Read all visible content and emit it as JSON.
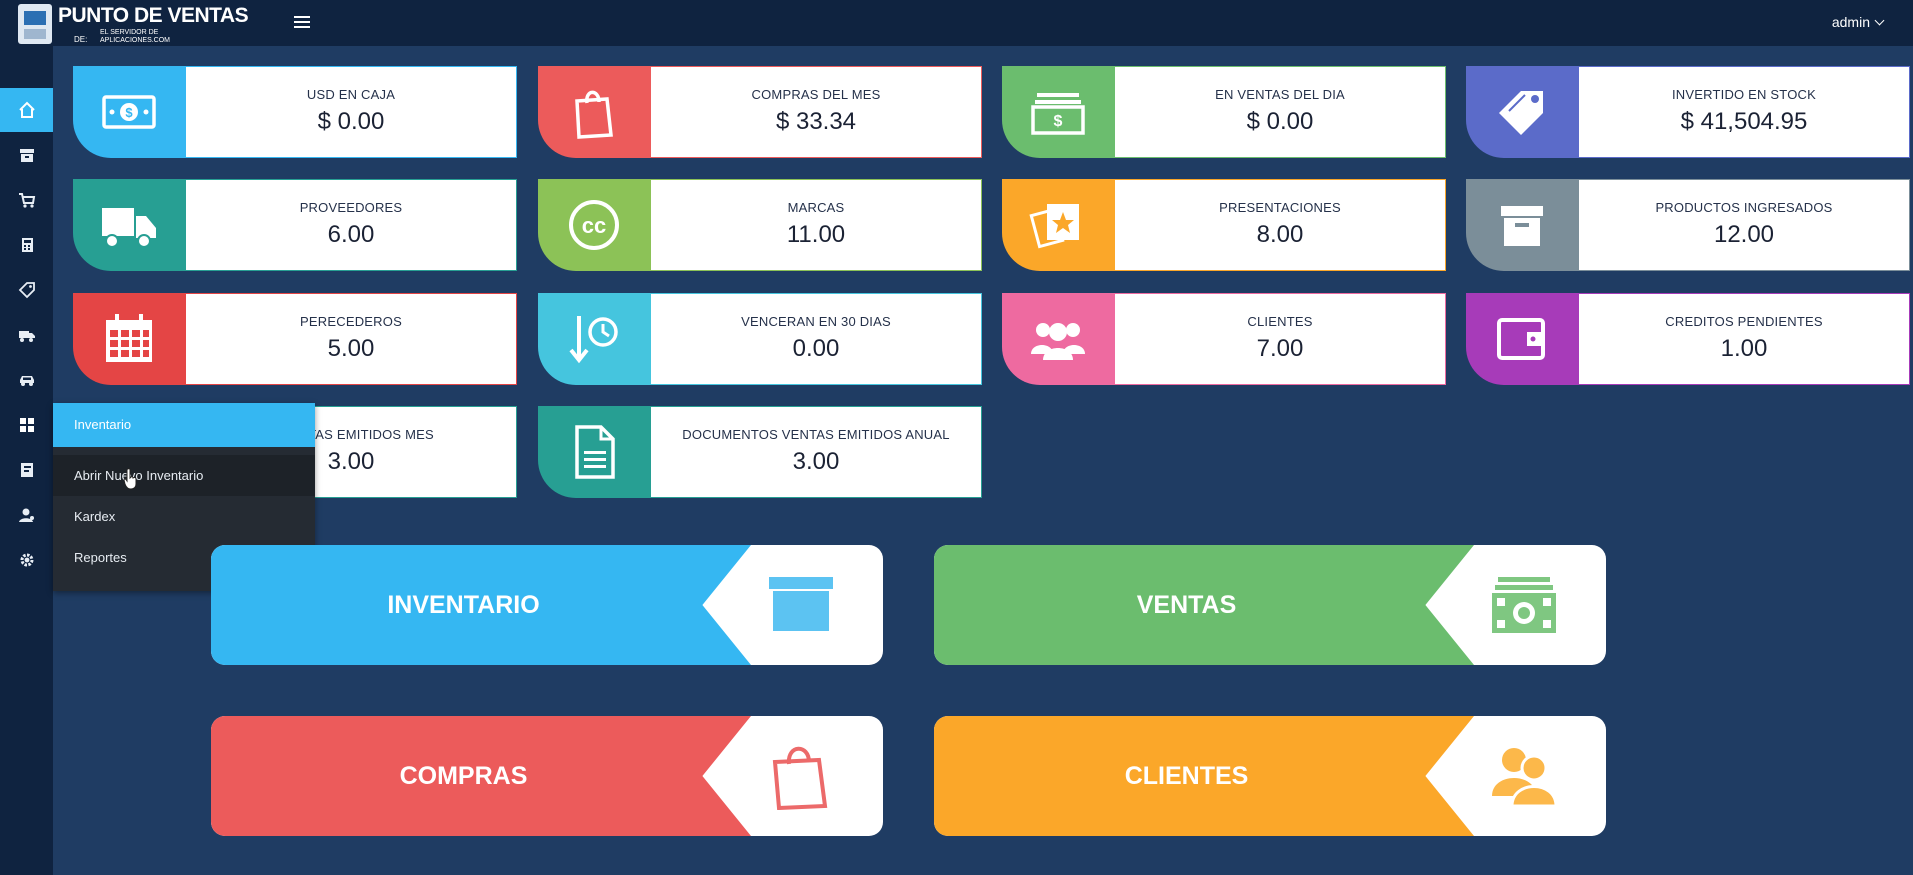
{
  "brand": {
    "title": "PUNTO DE VENTAS",
    "de": "DE:",
    "subtitle": "EL SERVIDOR DE APLICACIONES.COM"
  },
  "user": {
    "name": "admin"
  },
  "colors": {
    "blue": "#35b7f2",
    "red": "#ec5b5b",
    "green": "#6bbd6e",
    "indigo": "#5b6bc9",
    "teal": "#279f93",
    "lime": "#8cc257",
    "orange": "#fba729",
    "gray": "#7b8e99",
    "crimson": "#e44545",
    "cyan": "#45c5de",
    "pink": "#ee6aa0",
    "purple": "#a73bb9"
  },
  "sidebar": {
    "items": [
      {
        "icon": "home-icon"
      },
      {
        "icon": "archive-icon"
      },
      {
        "icon": "cart-icon"
      },
      {
        "icon": "calculator-icon"
      },
      {
        "icon": "tag-icon"
      },
      {
        "icon": "truck-icon"
      },
      {
        "icon": "car-icon"
      },
      {
        "icon": "grid-icon"
      },
      {
        "icon": "book-icon"
      },
      {
        "icon": "user-icon"
      },
      {
        "icon": "gear-icon"
      }
    ]
  },
  "dropdown": {
    "title": "Inventario",
    "items": [
      {
        "label": "Abrir Nuevo Inventario"
      },
      {
        "label": "Kardex"
      },
      {
        "label": "Reportes"
      }
    ]
  },
  "cards": [
    {
      "label": "USD EN CAJA",
      "value": "$ 0.00",
      "icon": "money-icon"
    },
    {
      "label": "COMPRAS DEL MES",
      "value": "$ 33.34",
      "icon": "shopping-bag-icon"
    },
    {
      "label": "EN VENTAS DEL DIA",
      "value": "$ 0.00",
      "icon": "cash-stack-icon"
    },
    {
      "label": "INVERTIDO EN STOCK",
      "value": "$ 41,504.95",
      "icon": "tags-icon"
    },
    {
      "label": "PROVEEDORES",
      "value": "6.00",
      "icon": "truck-icon"
    },
    {
      "label": "MARCAS",
      "value": "11.00",
      "icon": "cc-icon"
    },
    {
      "label": "PRESENTACIONES",
      "value": "8.00",
      "icon": "photos-icon"
    },
    {
      "label": "PRODUCTOS INGRESADOS",
      "value": "12.00",
      "icon": "archive-icon"
    },
    {
      "label": "PERECEDEROS",
      "value": "5.00",
      "icon": "calendar-icon"
    },
    {
      "label": "VENCERAN EN 30 DIAS",
      "value": "0.00",
      "icon": "history-icon"
    },
    {
      "label": "CLIENTES",
      "value": "7.00",
      "icon": "users-icon"
    },
    {
      "label": "CREDITOS PENDIENTES",
      "value": "1.00",
      "icon": "wallet-icon"
    },
    {
      "label": "S VENTAS EMITIDOS MES",
      "value": "3.00",
      "icon": "document-icon"
    },
    {
      "label": "DOCUMENTOS VENTAS EMITIDOS ANUAL",
      "value": "3.00",
      "icon": "document-icon"
    }
  ],
  "shortcuts": [
    {
      "label": "INVENTARIO",
      "icon": "archive-icon"
    },
    {
      "label": "VENTAS",
      "icon": "cash-icon"
    },
    {
      "label": "COMPRAS",
      "icon": "shopping-bag-icon"
    },
    {
      "label": "CLIENTES",
      "icon": "users-icon"
    }
  ]
}
